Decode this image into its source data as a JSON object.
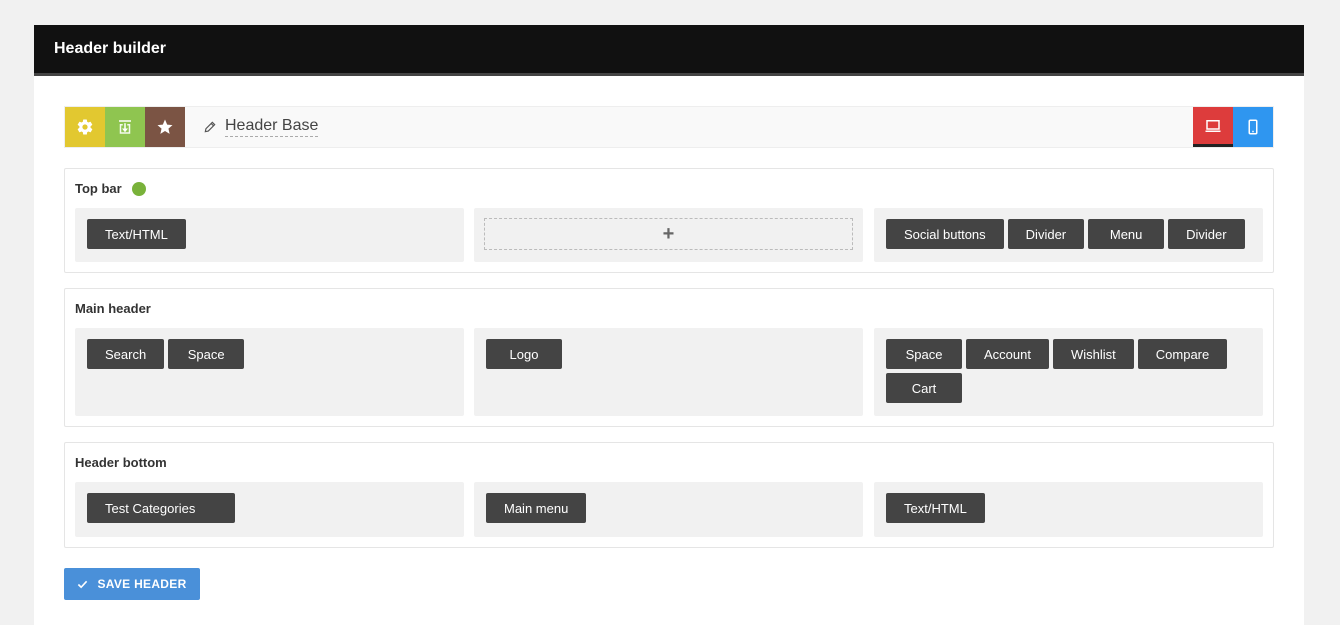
{
  "panel": {
    "title": "Header builder"
  },
  "toolbar": {
    "header_name": "Header Base",
    "settings_icon": "gear-icon",
    "import_icon": "import-icon",
    "favorite_icon": "star-icon",
    "desktop_icon": "desktop-icon",
    "mobile_icon": "mobile-icon"
  },
  "rows": [
    {
      "label": "Top bar",
      "active": true,
      "columns": [
        {
          "elements": [
            "Text/HTML"
          ]
        },
        {
          "elements": [],
          "add_label": "+"
        },
        {
          "elements": [
            "Social buttons",
            "Divider",
            "Menu",
            "Divider"
          ]
        }
      ]
    },
    {
      "label": "Main header",
      "columns": [
        {
          "elements": [
            "Search",
            "Space"
          ]
        },
        {
          "elements": [
            "Logo"
          ]
        },
        {
          "elements": [
            "Space",
            "Account",
            "Wishlist",
            "Compare",
            "Cart"
          ]
        }
      ]
    },
    {
      "label": "Header bottom",
      "columns": [
        {
          "elements": [
            "Test Categories"
          ]
        },
        {
          "elements": [
            "Main menu"
          ]
        },
        {
          "elements": [
            "Text/HTML"
          ]
        }
      ]
    }
  ],
  "save_button": {
    "label": "SAVE HEADER"
  },
  "colors": {
    "settings": "#e2c830",
    "import": "#8fc550",
    "favorite": "#7b5444",
    "desktop": "#dd3c3c",
    "mobile": "#2f96f0",
    "save": "#4a90d9",
    "active_dot": "#79b23a"
  }
}
